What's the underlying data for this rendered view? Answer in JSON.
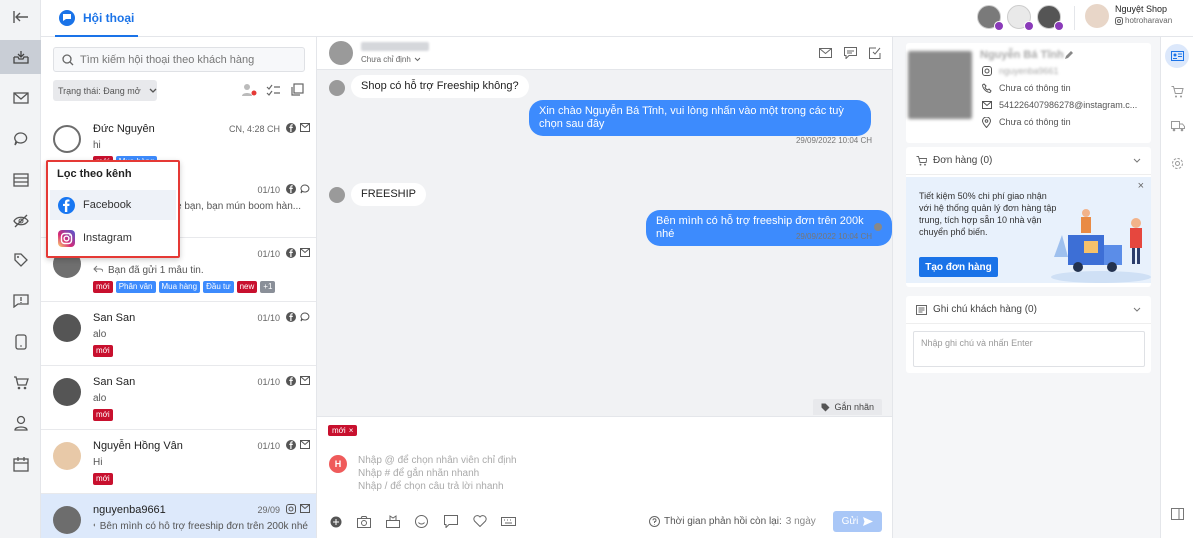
{
  "topbar": {
    "tab_label": "Hội thoại",
    "account_name": "Nguyệt Shop",
    "account_handle": "hotroharavan"
  },
  "list": {
    "search_placeholder": "Tìm kiếm hội thoại theo khách hàng",
    "status_filter": "Trạng thái: Đang mở",
    "conversations": [
      {
        "name": "Đức Nguyên",
        "time": "CN, 4:28 CH",
        "message": "hi",
        "tags": [
          "mới",
          "Mua hàng"
        ]
      },
      {
        "name": "",
        "time": "01/10",
        "message": "è bạn, bạn mún boom hàn...",
        "tags": []
      },
      {
        "name": "",
        "time": "01/10",
        "message": "Bạn đã gửi 1 mẫu tin.",
        "tags": [
          "mới",
          "Phân vân",
          "Mua hàng",
          "Đầu tư",
          "new",
          "+1"
        ]
      },
      {
        "name": "San San",
        "time": "01/10",
        "message": "alo",
        "tags": [
          "mới"
        ]
      },
      {
        "name": "San San",
        "time": "01/10",
        "message": "alo",
        "tags": [
          "mới"
        ]
      },
      {
        "name": "Nguyễn Hồng Vân",
        "time": "01/10",
        "message": "Hi",
        "tags": [
          "mới"
        ]
      },
      {
        "name": "nguyenba9661",
        "time": "29/09",
        "message": "Bên mình có hỗ trợ freeship đơn trên 200k nhé",
        "tags": []
      }
    ]
  },
  "channel_menu": {
    "title": "Lọc theo kênh",
    "items": [
      "Facebook",
      "Instagram"
    ]
  },
  "chat": {
    "header_status": "Chưa chỉ định",
    "messages": [
      {
        "dir": "in",
        "text": "Shop có hỗ trợ Freeship không?"
      },
      {
        "dir": "out",
        "text": "Xin chào Nguyễn Bá Tĩnh, vui lòng nhấn vào một trong các tuỳ chọn sau đây",
        "time": "29/09/2022 10:04 CH"
      },
      {
        "dir": "in",
        "text": "FREESHIP"
      },
      {
        "dir": "out",
        "text": "Bên mình có hỗ trợ freeship đơn trên 200k nhé",
        "time": "29/09/2022 10:04 CH"
      }
    ],
    "gan_nhan": "Gắn nhãn",
    "applied_tag": "mới",
    "composer_avatar": "H",
    "placeholders": [
      "Nhập @ để chọn nhân viên chỉ định",
      "Nhập # để gắn nhãn nhanh",
      "Nhập / để chọn câu trả lời nhanh"
    ],
    "response_time_label": "Thời gian phản hồi còn lại:",
    "response_time_value": "3 ngày",
    "send_label": "Gửi"
  },
  "customer": {
    "name": "Nguyễn Bá Tĩnh",
    "username": "nguyenba9661",
    "phone": "Chưa có thông tin",
    "email": "541226407986278@instagram.c...",
    "address": "Chưa có thông tin",
    "orders_title": "Đơn hàng (0)",
    "promo_text": "Tiết kiệm 50% chi phí giao nhận với hệ thống quản lý đơn hàng tập trung, tích hợp sẵn 10 nhà vận chuyển phổ biến.",
    "create_order": "Tạo đơn hàng",
    "notes_title": "Ghi chú khách hàng (0)",
    "notes_placeholder": "Nhập ghi chú và nhấn Enter"
  },
  "colors": {
    "accent": "#1a73e8",
    "bubble_out": "#3d8bfd",
    "tag_red": "#c8102e",
    "highlight_border": "#e53935"
  }
}
